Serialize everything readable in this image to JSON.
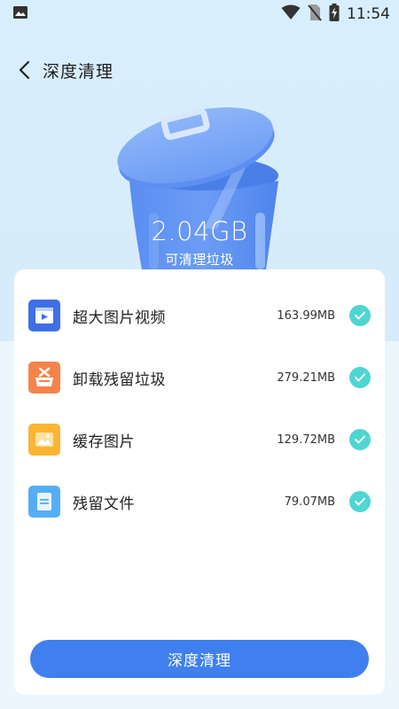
{
  "status_bar": {
    "time": "11:54"
  },
  "header": {
    "title": "深度清理"
  },
  "summary": {
    "size": "2.04GB",
    "label": "可清理垃圾"
  },
  "items": [
    {
      "label": "超大图片视频",
      "size": "163.99MB",
      "icon": "video-icon",
      "checked": true
    },
    {
      "label": "卸载残留垃圾",
      "size": "279.21MB",
      "icon": "uninstall-residue-icon",
      "checked": true
    },
    {
      "label": "缓存图片",
      "size": "129.72MB",
      "icon": "image-icon",
      "checked": true
    },
    {
      "label": "残留文件",
      "size": "79.07MB",
      "icon": "file-icon",
      "checked": true
    }
  ],
  "action": {
    "clean_label": "深度清理"
  },
  "colors": {
    "accent": "#3f80ee",
    "check": "#4fd6d2",
    "bin": "#5b8ff2"
  }
}
